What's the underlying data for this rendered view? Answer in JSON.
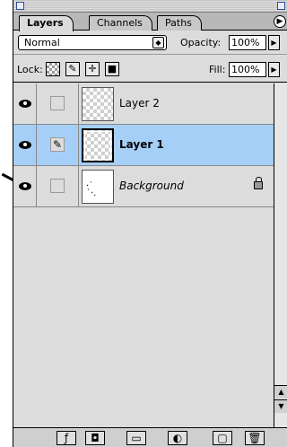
{
  "tabs": [
    {
      "label": "Layers",
      "active": true
    },
    {
      "label": "Channels",
      "active": false
    },
    {
      "label": "Paths",
      "active": false
    }
  ],
  "blend": {
    "mode": "Normal",
    "opacity_label": "Opacity:",
    "opacity_value": "100%"
  },
  "lock": {
    "label": "Lock:",
    "fill_label": "Fill:",
    "fill_value": "100%"
  },
  "layers": [
    {
      "name": "Layer 2",
      "visible": true,
      "selected": false
    },
    {
      "name": "Layer 1",
      "visible": true,
      "selected": true
    },
    {
      "name": "Background",
      "visible": true,
      "selected": false,
      "locked": true
    }
  ],
  "colors": {
    "selection": "#a6cff8",
    "panel": "#dcdcdc"
  },
  "icons": {
    "panel-menu": "triangle-right",
    "brush": "brush-icon",
    "move": "move-icon",
    "lock": "lock-icon",
    "eye": "eye-icon"
  }
}
